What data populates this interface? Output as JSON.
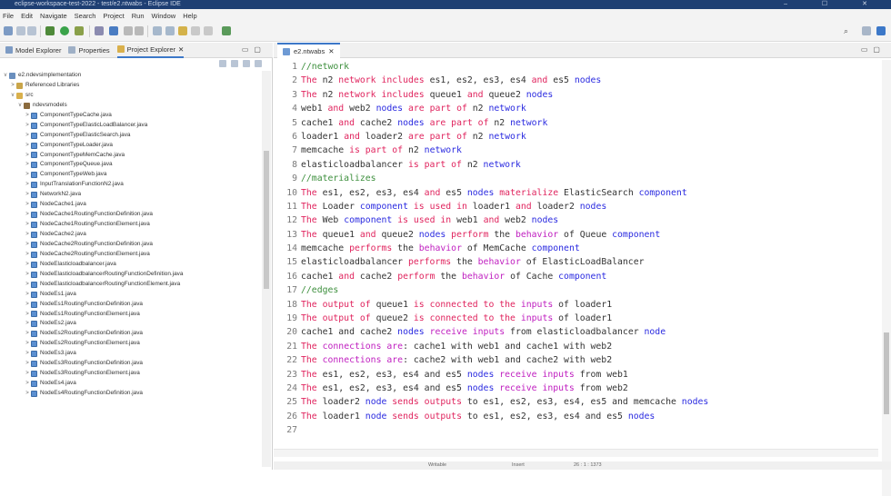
{
  "window": {
    "title": "eclipse-workspace-test-2022 - test/e2.ntwabs - Eclipse IDE",
    "controls": "–  ☐  ✕"
  },
  "menu": [
    "File",
    "Edit",
    "Navigate",
    "Search",
    "Project",
    "Run",
    "Window",
    "Help"
  ],
  "left_panel": {
    "tabs": [
      {
        "label": "Model Explorer",
        "active": false
      },
      {
        "label": "Properties",
        "active": false
      },
      {
        "label": "Project Explorer",
        "active": true,
        "close": "✕"
      }
    ],
    "tree": [
      {
        "depth": 0,
        "arrow": "v",
        "icon": "project",
        "label": "e2.ndevsimplementation"
      },
      {
        "depth": 1,
        "arrow": ">",
        "icon": "library",
        "label": "Referenced Libraries"
      },
      {
        "depth": 1,
        "arrow": "v",
        "icon": "source-folder",
        "label": "src"
      },
      {
        "depth": 2,
        "arrow": "v",
        "icon": "package",
        "label": "ndevsmodels"
      },
      {
        "depth": 3,
        "arrow": ">",
        "icon": "java",
        "label": "ComponentTypeCache.java"
      },
      {
        "depth": 3,
        "arrow": ">",
        "icon": "java",
        "label": "ComponentTypeElasticLoadBalancer.java"
      },
      {
        "depth": 3,
        "arrow": ">",
        "icon": "java",
        "label": "ComponentTypeElasticSearch.java"
      },
      {
        "depth": 3,
        "arrow": ">",
        "icon": "java",
        "label": "ComponentTypeLoader.java"
      },
      {
        "depth": 3,
        "arrow": ">",
        "icon": "java",
        "label": "ComponentTypeMemCache.java"
      },
      {
        "depth": 3,
        "arrow": ">",
        "icon": "java",
        "label": "ComponentTypeQueue.java"
      },
      {
        "depth": 3,
        "arrow": ">",
        "icon": "java",
        "label": "ComponentTypeWeb.java"
      },
      {
        "depth": 3,
        "arrow": ">",
        "icon": "java",
        "label": "InputTranslationFunctionN2.java"
      },
      {
        "depth": 3,
        "arrow": ">",
        "icon": "java",
        "label": "NetworkN2.java"
      },
      {
        "depth": 3,
        "arrow": ">",
        "icon": "java",
        "label": "NodeCache1.java"
      },
      {
        "depth": 3,
        "arrow": ">",
        "icon": "java",
        "label": "NodeCache1RoutingFunctionDefinition.java"
      },
      {
        "depth": 3,
        "arrow": ">",
        "icon": "java",
        "label": "NodeCache1RoutingFunctionElement.java"
      },
      {
        "depth": 3,
        "arrow": ">",
        "icon": "java",
        "label": "NodeCache2.java"
      },
      {
        "depth": 3,
        "arrow": ">",
        "icon": "java",
        "label": "NodeCache2RoutingFunctionDefinition.java"
      },
      {
        "depth": 3,
        "arrow": ">",
        "icon": "java",
        "label": "NodeCache2RoutingFunctionElement.java"
      },
      {
        "depth": 3,
        "arrow": ">",
        "icon": "java",
        "label": "NodeElasticloadbalancer.java"
      },
      {
        "depth": 3,
        "arrow": ">",
        "icon": "java",
        "label": "NodeElasticloadbalancerRoutingFunctionDefinition.java"
      },
      {
        "depth": 3,
        "arrow": ">",
        "icon": "java",
        "label": "NodeElasticloadbalancerRoutingFunctionElement.java"
      },
      {
        "depth": 3,
        "arrow": ">",
        "icon": "java",
        "label": "NodeEs1.java"
      },
      {
        "depth": 3,
        "arrow": ">",
        "icon": "java",
        "label": "NodeEs1RoutingFunctionDefinition.java"
      },
      {
        "depth": 3,
        "arrow": ">",
        "icon": "java",
        "label": "NodeEs1RoutingFunctionElement.java"
      },
      {
        "depth": 3,
        "arrow": ">",
        "icon": "java",
        "label": "NodeEs2.java"
      },
      {
        "depth": 3,
        "arrow": ">",
        "icon": "java",
        "label": "NodeEs2RoutingFunctionDefinition.java"
      },
      {
        "depth": 3,
        "arrow": ">",
        "icon": "java",
        "label": "NodeEs2RoutingFunctionElement.java"
      },
      {
        "depth": 3,
        "arrow": ">",
        "icon": "java",
        "label": "NodeEs3.java"
      },
      {
        "depth": 3,
        "arrow": ">",
        "icon": "java",
        "label": "NodeEs3RoutingFunctionDefinition.java"
      },
      {
        "depth": 3,
        "arrow": ">",
        "icon": "java",
        "label": "NodeEs3RoutingFunctionElement.java"
      },
      {
        "depth": 3,
        "arrow": ">",
        "icon": "java",
        "label": "NodeEs4.java"
      },
      {
        "depth": 3,
        "arrow": ">",
        "icon": "java",
        "label": "NodeEs4RoutingFunctionDefinition.java"
      }
    ]
  },
  "editor": {
    "tab": {
      "label": "e2.ntwabs",
      "close": "✕"
    },
    "lines": [
      {
        "n": "1",
        "t": [
          [
            "c",
            "//network"
          ]
        ]
      },
      {
        "n": "2",
        "t": [
          [
            "r",
            "The"
          ],
          [
            "p",
            " n2 "
          ],
          [
            "r",
            "network includes"
          ],
          [
            "p",
            " es1, es2, es3, es4 "
          ],
          [
            "r",
            "and"
          ],
          [
            "p",
            " es5 "
          ],
          [
            "b",
            "nodes"
          ]
        ]
      },
      {
        "n": "3",
        "t": [
          [
            "r",
            "The"
          ],
          [
            "p",
            " n2 "
          ],
          [
            "r",
            "network includes"
          ],
          [
            "p",
            " queue1 "
          ],
          [
            "r",
            "and"
          ],
          [
            "p",
            " queue2 "
          ],
          [
            "b",
            "nodes"
          ]
        ]
      },
      {
        "n": "4",
        "t": [
          [
            "p",
            "web1 "
          ],
          [
            "r",
            "and"
          ],
          [
            "p",
            " web2 "
          ],
          [
            "b",
            "nodes"
          ],
          [
            "r",
            " are part of"
          ],
          [
            "p",
            " n2 "
          ],
          [
            "b",
            "network"
          ]
        ]
      },
      {
        "n": "5",
        "t": [
          [
            "p",
            "cache1 "
          ],
          [
            "r",
            "and"
          ],
          [
            "p",
            " cache2 "
          ],
          [
            "b",
            "nodes"
          ],
          [
            "r",
            " are part of"
          ],
          [
            "p",
            " n2 "
          ],
          [
            "b",
            "network"
          ]
        ]
      },
      {
        "n": "6",
        "t": [
          [
            "p",
            "loader1 "
          ],
          [
            "r",
            "and"
          ],
          [
            "p",
            " loader2 "
          ],
          [
            "r",
            "are part of"
          ],
          [
            "p",
            " n2 "
          ],
          [
            "b",
            "network"
          ]
        ]
      },
      {
        "n": "7",
        "t": [
          [
            "p",
            "memcache "
          ],
          [
            "r",
            "is part of"
          ],
          [
            "p",
            " n2 "
          ],
          [
            "b",
            "network"
          ]
        ]
      },
      {
        "n": "8",
        "t": [
          [
            "p",
            "elasticloadbalancer "
          ],
          [
            "r",
            "is part of"
          ],
          [
            "p",
            " n2 "
          ],
          [
            "b",
            "network"
          ]
        ]
      },
      {
        "n": "9",
        "t": [
          [
            "c",
            "//materializes"
          ]
        ]
      },
      {
        "n": "10",
        "t": [
          [
            "r",
            "The"
          ],
          [
            "p",
            " es1, es2, es3, es4 "
          ],
          [
            "r",
            "and"
          ],
          [
            "p",
            " es5 "
          ],
          [
            "b",
            "nodes"
          ],
          [
            "r",
            " materialize"
          ],
          [
            "p",
            " ElasticSearch "
          ],
          [
            "b",
            "component"
          ]
        ]
      },
      {
        "n": "11",
        "t": [
          [
            "r",
            "The"
          ],
          [
            "p",
            " Loader "
          ],
          [
            "b",
            "component"
          ],
          [
            "r",
            " is used in"
          ],
          [
            "p",
            " loader1 "
          ],
          [
            "r",
            "and"
          ],
          [
            "p",
            " loader2 "
          ],
          [
            "b",
            "nodes"
          ]
        ]
      },
      {
        "n": "12",
        "t": [
          [
            "r",
            "The"
          ],
          [
            "p",
            " Web "
          ],
          [
            "b",
            "component"
          ],
          [
            "r",
            " is used in"
          ],
          [
            "p",
            " web1 "
          ],
          [
            "r",
            "and"
          ],
          [
            "p",
            " web2 "
          ],
          [
            "b",
            "nodes"
          ]
        ]
      },
      {
        "n": "13",
        "t": [
          [
            "r",
            "The"
          ],
          [
            "p",
            " queue1 "
          ],
          [
            "r",
            "and"
          ],
          [
            "p",
            " queue2 "
          ],
          [
            "b",
            "nodes"
          ],
          [
            "r",
            " perform"
          ],
          [
            "p",
            " the "
          ],
          [
            "m",
            "behavior"
          ],
          [
            "p",
            " of Queue "
          ],
          [
            "b",
            "component"
          ]
        ]
      },
      {
        "n": "14",
        "t": [
          [
            "p",
            "memcache "
          ],
          [
            "r",
            "performs"
          ],
          [
            "p",
            " the "
          ],
          [
            "m",
            "behavior"
          ],
          [
            "p",
            " of MemCache "
          ],
          [
            "b",
            "component"
          ]
        ]
      },
      {
        "n": "15",
        "t": [
          [
            "p",
            "elasticloadbalancer "
          ],
          [
            "r",
            "performs"
          ],
          [
            "p",
            " the "
          ],
          [
            "m",
            "behavior"
          ],
          [
            "p",
            " of ElasticLoadBalancer"
          ]
        ]
      },
      {
        "n": "16",
        "t": [
          [
            "p",
            "cache1 "
          ],
          [
            "r",
            "and"
          ],
          [
            "p",
            " cache2 "
          ],
          [
            "r",
            "perform"
          ],
          [
            "p",
            " the "
          ],
          [
            "m",
            "behavior"
          ],
          [
            "p",
            " of Cache "
          ],
          [
            "b",
            "component"
          ]
        ]
      },
      {
        "n": "17",
        "t": [
          [
            "c",
            "//edges"
          ]
        ]
      },
      {
        "n": "18",
        "t": [
          [
            "r",
            "The output of"
          ],
          [
            "p",
            " queue1 "
          ],
          [
            "r",
            "is connected to the"
          ],
          [
            "m",
            " inputs"
          ],
          [
            "p",
            " of loader1"
          ]
        ]
      },
      {
        "n": "19",
        "t": [
          [
            "r",
            "The output of"
          ],
          [
            "p",
            " queue2 "
          ],
          [
            "r",
            "is connected to the"
          ],
          [
            "m",
            " inputs"
          ],
          [
            "p",
            " of loader1"
          ]
        ]
      },
      {
        "n": "20",
        "t": [
          [
            "p",
            "cache1 and cache2 "
          ],
          [
            "b",
            "nodes"
          ],
          [
            "m",
            " receive inputs"
          ],
          [
            "p",
            " from elasticloadbalancer "
          ],
          [
            "b",
            "node"
          ]
        ]
      },
      {
        "n": "21",
        "t": [
          [
            "r",
            "The"
          ],
          [
            "m",
            " connections are"
          ],
          [
            "p",
            ": cache1 with web1 and cache1 with web2"
          ]
        ]
      },
      {
        "n": "22",
        "t": [
          [
            "r",
            "The"
          ],
          [
            "m",
            " connections are"
          ],
          [
            "p",
            ": cache2 with web1 and cache2 with web2"
          ]
        ]
      },
      {
        "n": "23",
        "t": [
          [
            "r",
            "The"
          ],
          [
            "p",
            " es1, es2, es3, es4 and es5 "
          ],
          [
            "b",
            "nodes"
          ],
          [
            "m",
            " receive inputs"
          ],
          [
            "p",
            " from web1"
          ]
        ]
      },
      {
        "n": "24",
        "t": [
          [
            "r",
            "The"
          ],
          [
            "p",
            " es1, es2, es3, es4 and es5 "
          ],
          [
            "b",
            "nodes"
          ],
          [
            "m",
            " receive inputs"
          ],
          [
            "p",
            " from web2"
          ]
        ]
      },
      {
        "n": "25",
        "t": [
          [
            "r",
            "The"
          ],
          [
            "p",
            " loader2 "
          ],
          [
            "b",
            "node"
          ],
          [
            "r",
            " sends outputs"
          ],
          [
            "p",
            " to es1, es2, es3, es4, es5 and memcache "
          ],
          [
            "b",
            "nodes"
          ]
        ]
      },
      {
        "n": "26",
        "t": [
          [
            "r",
            "The"
          ],
          [
            "p",
            " loader1 "
          ],
          [
            "b",
            "node"
          ],
          [
            "r",
            " sends outputs"
          ],
          [
            "p",
            " to es1, es2, es3, es4 and es5 "
          ],
          [
            "b",
            "nodes"
          ]
        ]
      },
      {
        "n": "27",
        "t": []
      }
    ]
  },
  "status": {
    "writable": "Writable",
    "insert": "Insert",
    "position": "26 : 1 : 1373"
  },
  "colors": {
    "titlebar": "#1e3f73",
    "keyword_red": "#e0245e",
    "keyword_magenta": "#c020c0",
    "keyword_blue": "#2a2ae0",
    "comment": "#3d8f3d"
  }
}
